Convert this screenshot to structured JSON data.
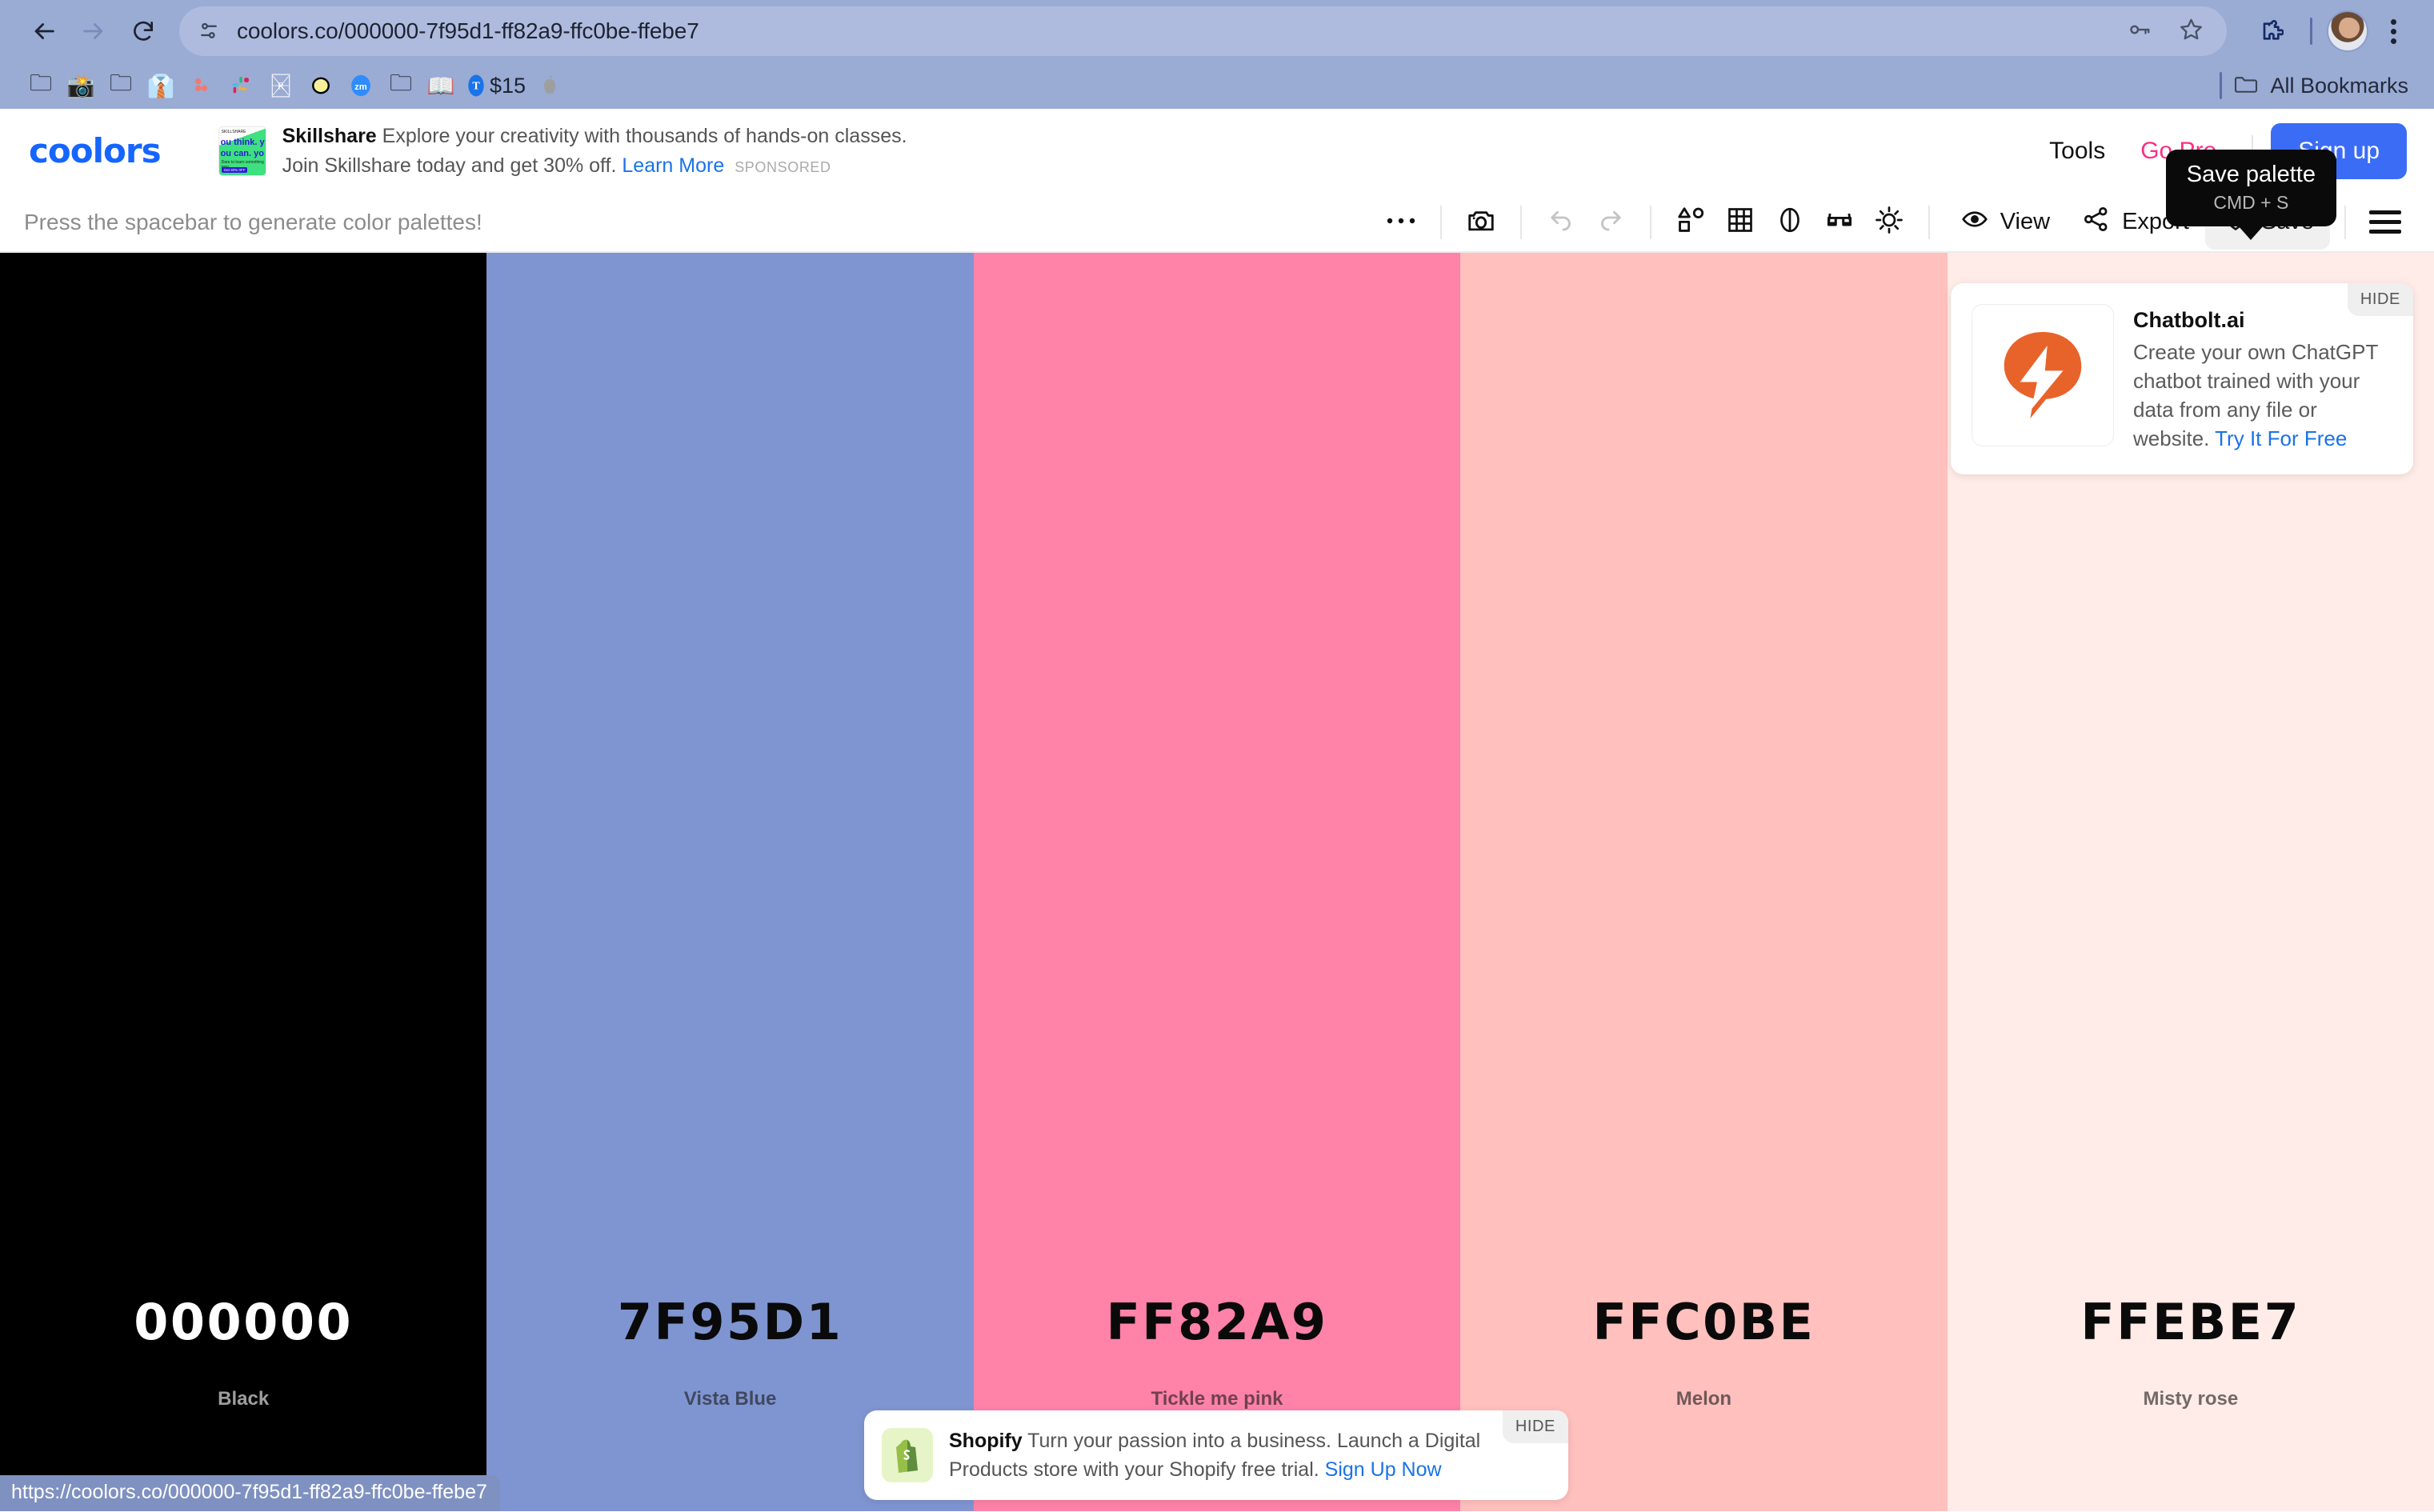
{
  "browser": {
    "url": "coolors.co/000000-7f95d1-ff82a9-ffc0be-ffebe7",
    "status_url": "https://coolors.co/000000-7f95d1-ff82a9-ffc0be-ffebe7",
    "back_icon": "back-arrow-icon",
    "forward_icon": "forward-arrow-icon",
    "reload_icon": "reload-icon",
    "site_settings_icon": "site-settings-icon",
    "password_icon": "key-icon",
    "bookmark_icon": "star-icon",
    "extensions_icon": "puzzle-icon",
    "profile_icon": "avatar-icon",
    "menu_icon": "kebab-menu-icon",
    "bookmarks": [
      {
        "icon": "📁",
        "label": ""
      },
      {
        "icon": "📸",
        "label": ""
      },
      {
        "icon": "📁",
        "label": ""
      },
      {
        "icon": "👔",
        "label": ""
      },
      {
        "icon": "⋰",
        "label": ""
      },
      {
        "icon": "◈",
        "label": ""
      },
      {
        "icon": "▣",
        "label": ""
      },
      {
        "icon": "◍",
        "label": ""
      },
      {
        "icon": "zm",
        "label": ""
      },
      {
        "icon": "📁",
        "label": ""
      },
      {
        "icon": "📖",
        "label": ""
      },
      {
        "icon": "T",
        "label": "$15"
      },
      {
        "icon": "🍎",
        "label": ""
      }
    ],
    "all_bookmarks_label": "All Bookmarks"
  },
  "header": {
    "logo": "coolors",
    "ad": {
      "brand": "Skillshare",
      "body": "Explore your creativity with thousands of hands-on classes. Join Skillshare today and get 30% off.",
      "link": "Learn More",
      "sponsored": "SPONSORED",
      "thumb_line1": "SKILLSHARE",
      "thumb_line2": "ou think. y",
      "thumb_line3": "ou can. yo",
      "thumb_line4": "Dare to learn something new.",
      "thumb_line5": "Get 30% 0FF"
    },
    "tools_label": "Tools",
    "go_pro_label": "Go Pro",
    "signup_label": "Sign up",
    "tooltip": {
      "title": "Save palette",
      "shortcut": "CMD + S"
    }
  },
  "toolbar": {
    "hint": "Press the spacebar to generate color palettes!",
    "more_icon": "more-dots-icon",
    "camera_icon": "camera-icon",
    "undo_icon": "undo-icon",
    "redo_icon": "redo-icon",
    "shapes_icon": "shapes-icon",
    "grid_icon": "grid-icon",
    "contrast_icon": "contrast-icon",
    "glasses_icon": "glasses-icon",
    "brightness_icon": "brightness-icon",
    "view_label": "View",
    "view_icon": "eye-icon",
    "export_label": "Export",
    "export_icon": "share-icon",
    "save_label": "Save",
    "save_icon": "heart-icon",
    "menu_icon": "hamburger-icon"
  },
  "palette": {
    "swatches": [
      {
        "hex": "000000",
        "name": "Black",
        "color": "#000000",
        "mode": "dark"
      },
      {
        "hex": "7F95D1",
        "name": "Vista Blue",
        "color": "#7F95D1",
        "mode": "light"
      },
      {
        "hex": "FF82A9",
        "name": "Tickle me pink",
        "color": "#FF82A9",
        "mode": "light"
      },
      {
        "hex": "FFC0BE",
        "name": "Melon",
        "color": "#FFC0BE",
        "mode": "light"
      },
      {
        "hex": "FFEBE7",
        "name": "Misty rose",
        "color": "#FFEBE7",
        "mode": "light"
      }
    ]
  },
  "side_ad": {
    "title": "Chatbolt.ai",
    "body": "Create your own ChatGPT chatbot trained with your data from any file or website. ",
    "link": "Try It For Free",
    "hide_label": "HIDE",
    "logo_color": "#E8632A"
  },
  "bottom_ad": {
    "brand": "Shopify",
    "body": "Turn your passion into a business. Launch a Digital Products store with your Shopify free trial. ",
    "link": "Sign Up Now",
    "hide_label": "HIDE",
    "logo_color": "#95BF47"
  }
}
